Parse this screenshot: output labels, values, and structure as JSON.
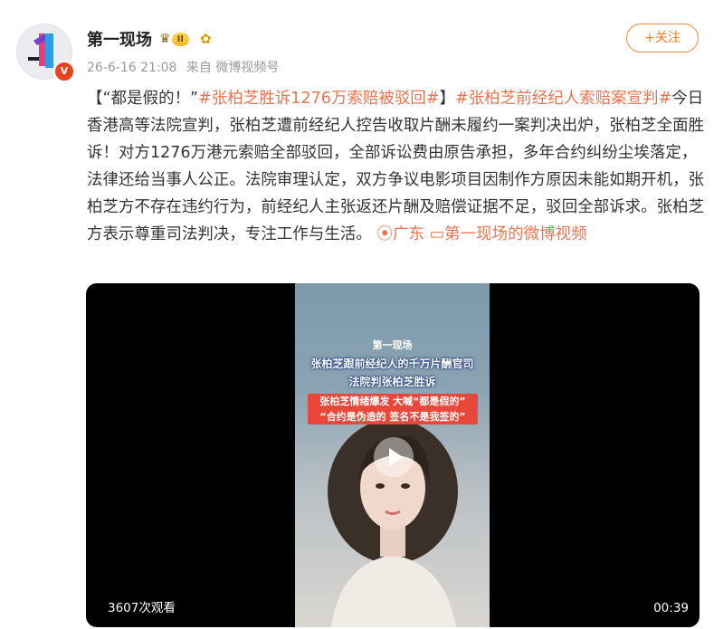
{
  "author": {
    "name": "第一现场",
    "level": "II",
    "verified_mark": "V",
    "icons": [
      "crown-icon",
      "sunflower-icon"
    ]
  },
  "meta": {
    "time": "26-6-16 21:08",
    "source": "来自 微博视频号"
  },
  "follow": {
    "label": "+关注"
  },
  "post": {
    "prefix": "【“都是假的！”",
    "tag1": "#张柏芝胜诉1276万索赔被驳回#",
    "mid": "】",
    "tag2": "#张柏芝前经纪人索赔案宣判#",
    "body": "今日香港高等法院宣判，张柏芝遭前经纪人控告收取片酬未履约一案判决出炉，张柏芝全面胜诉！对方1276万港元索赔全部驳回，全部诉讼费由原告承担，多年合约纠纷尘埃落定，法律还给当事人公正。法院审理认定，双方争议电影项目因制作方原因未能如期开机，张柏芝方不存在违约行为，前经纪人主张返还片酬及赔偿证据不足，驳回全部诉求。张柏芝方表示尊重司法判决，专注工作与生活。",
    "location": "广东",
    "video_link": "第一现场的微博视频"
  },
  "video": {
    "overlay_brand": "第一现场",
    "overlay_line1": "张柏芝跟前经纪人的千万片酬官司",
    "overlay_line2": "法院判张柏芝胜诉",
    "overlay_red1": "张柏芝情绪爆发 大喊“都是假的”",
    "overlay_red2": "“合约是伪造的 签名不是我签的”",
    "views": "3607次观看",
    "duration": "00:39"
  },
  "colors": {
    "accent": "#eb7350",
    "badge": "#e8431e",
    "follow": "#f07a22"
  }
}
